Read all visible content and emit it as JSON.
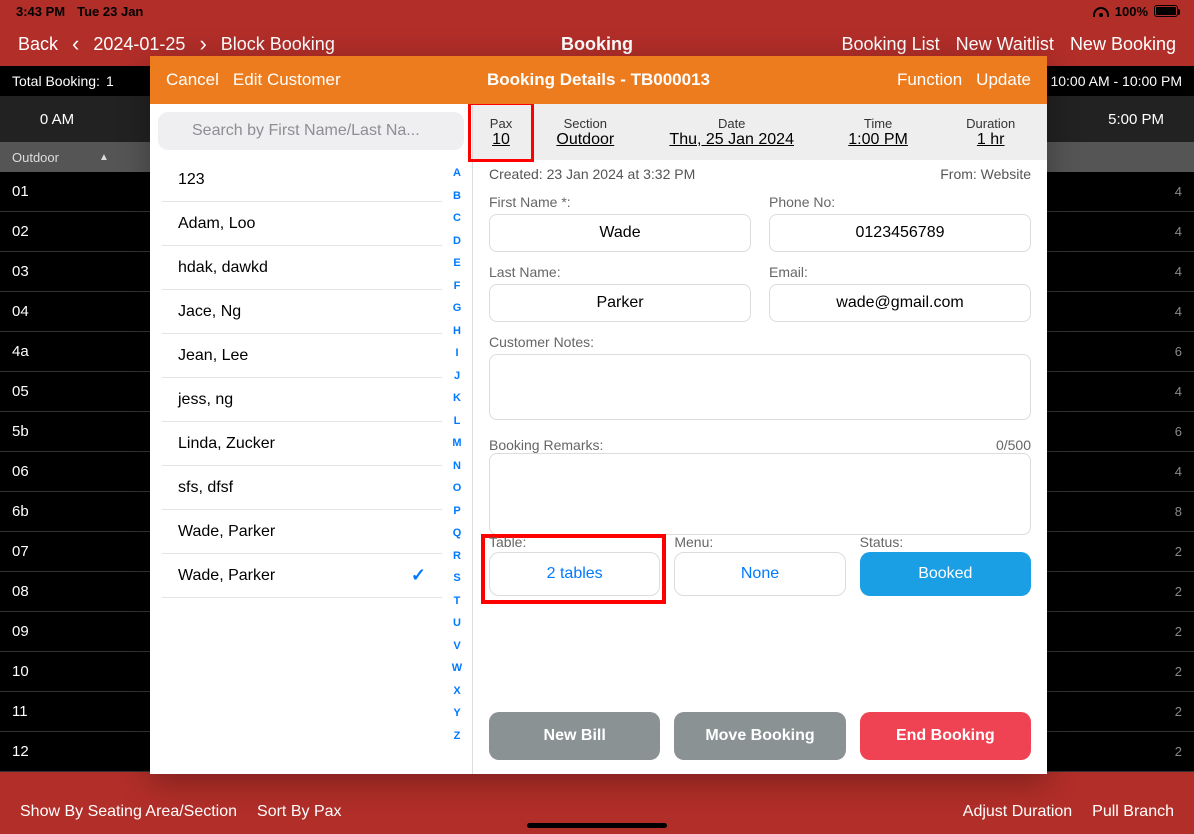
{
  "status": {
    "time": "3:43 PM",
    "date": "Tue 23 Jan",
    "battery": "100%"
  },
  "nav": {
    "back": "Back",
    "date": "2024-01-25",
    "block_booking": "Block Booking",
    "title": "Booking",
    "booking_list": "Booking List",
    "new_waitlist": "New Waitlist",
    "new_booking": "New Booking"
  },
  "sub_bar": {
    "total_label": "Total Booking:",
    "total_value": "1",
    "hours": "10:00 AM - 10:00 PM"
  },
  "time_header": {
    "left": "0 AM",
    "right": "5:00 PM"
  },
  "section": {
    "name": "Outdoor"
  },
  "tables": [
    {
      "name": "01",
      "pax": "4"
    },
    {
      "name": "02",
      "pax": "4"
    },
    {
      "name": "03",
      "pax": "4"
    },
    {
      "name": "04",
      "pax": "4"
    },
    {
      "name": "4a",
      "pax": "6"
    },
    {
      "name": "05",
      "pax": "4"
    },
    {
      "name": "5b",
      "pax": "6"
    },
    {
      "name": "06",
      "pax": "4"
    },
    {
      "name": "6b",
      "pax": "8"
    },
    {
      "name": "07",
      "pax": "2"
    },
    {
      "name": "08",
      "pax": "2"
    },
    {
      "name": "09",
      "pax": "2"
    },
    {
      "name": "10",
      "pax": "2"
    },
    {
      "name": "11",
      "pax": "2"
    },
    {
      "name": "12",
      "pax": "2"
    }
  ],
  "bottom": {
    "show_by": "Show By Seating Area/Section",
    "sort_by": "Sort By Pax",
    "adjust": "Adjust Duration",
    "pull": "Pull Branch"
  },
  "modal": {
    "cancel": "Cancel",
    "edit_customer": "Edit Customer",
    "title": "Booking Details - TB000013",
    "function": "Function",
    "update": "Update",
    "search_placeholder": "Search by First Name/Last Na...",
    "contacts": [
      {
        "name": "123",
        "selected": false
      },
      {
        "name": "Adam, Loo",
        "selected": false
      },
      {
        "name": "hdak, dawkd",
        "selected": false
      },
      {
        "name": "Jace, Ng",
        "selected": false
      },
      {
        "name": "Jean, Lee",
        "selected": false
      },
      {
        "name": "jess, ng",
        "selected": false
      },
      {
        "name": "Linda, Zucker",
        "selected": false
      },
      {
        "name": "sfs, dfsf",
        "selected": false
      },
      {
        "name": "Wade, Parker",
        "selected": false
      },
      {
        "name": "Wade, Parker",
        "selected": true
      }
    ],
    "alpha": [
      "A",
      "B",
      "C",
      "D",
      "E",
      "F",
      "G",
      "H",
      "I",
      "J",
      "K",
      "L",
      "M",
      "N",
      "O",
      "P",
      "Q",
      "R",
      "S",
      "T",
      "U",
      "V",
      "W",
      "X",
      "Y",
      "Z"
    ],
    "summary": {
      "pax": {
        "label": "Pax",
        "value": "10"
      },
      "section": {
        "label": "Section",
        "value": "Outdoor"
      },
      "date": {
        "label": "Date",
        "value": "Thu, 25 Jan 2024"
      },
      "time": {
        "label": "Time",
        "value": "1:00 PM"
      },
      "duration": {
        "label": "Duration",
        "value": "1 hr"
      }
    },
    "meta": {
      "created": "Created: 23 Jan 2024 at 3:32 PM",
      "from": "From: Website"
    },
    "form": {
      "first_name_label": "First Name *:",
      "first_name": "Wade",
      "phone_label": "Phone No:",
      "phone": "0123456789",
      "last_name_label": "Last Name:",
      "last_name": "Parker",
      "email_label": "Email:",
      "email": "wade@gmail.com",
      "notes_label": "Customer Notes:",
      "notes": "",
      "remarks_label": "Booking Remarks:",
      "remarks_count": "0/500",
      "remarks": "",
      "table_label": "Table:",
      "table_value": "2 tables",
      "menu_label": "Menu:",
      "menu_value": "None",
      "status_label": "Status:",
      "status_value": "Booked"
    },
    "actions": {
      "new_bill": "New Bill",
      "move_booking": "Move Booking",
      "end_booking": "End Booking"
    }
  }
}
